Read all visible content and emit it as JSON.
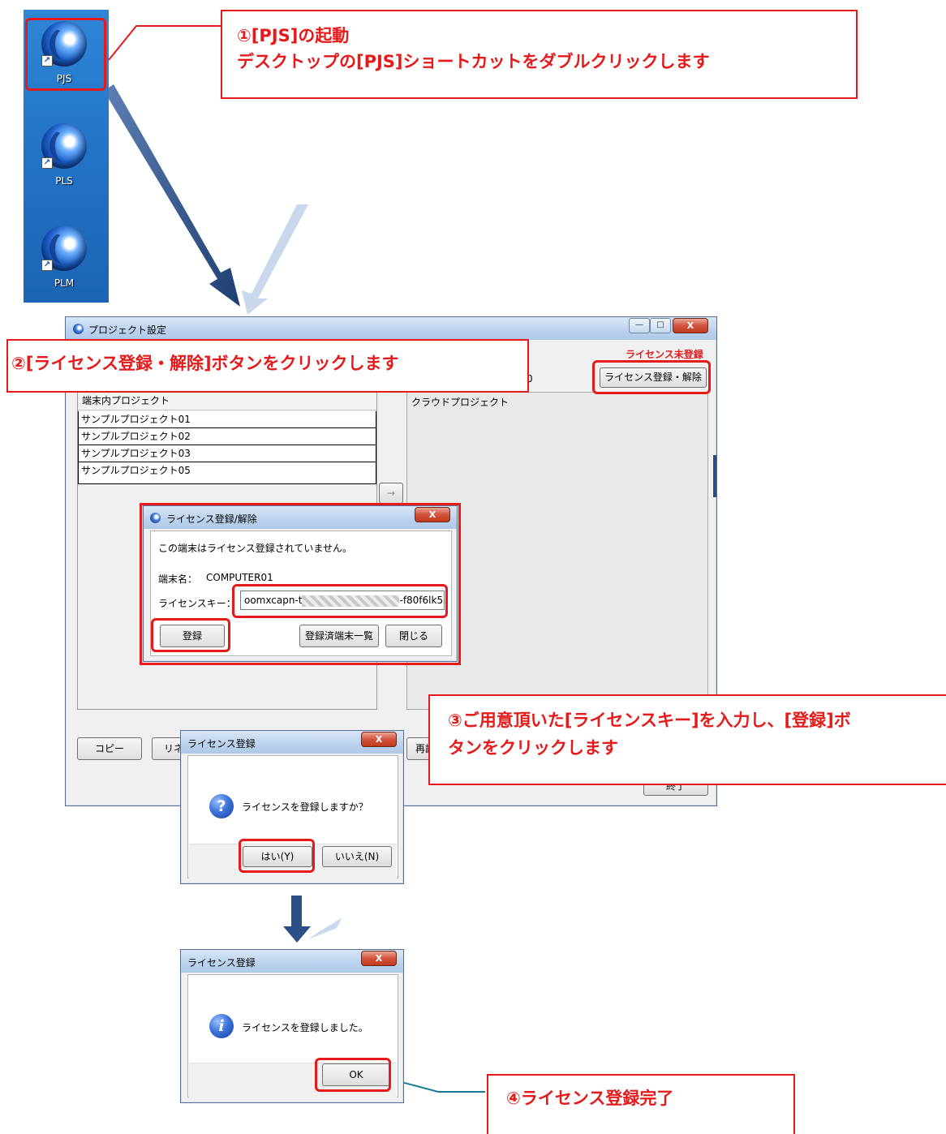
{
  "desktop": {
    "icons": [
      {
        "label": "PJS",
        "shortcut": "↗"
      },
      {
        "label": "PLS",
        "shortcut": "↗"
      },
      {
        "label": "PLM",
        "shortcut": "↗"
      }
    ]
  },
  "callouts": {
    "step1_line1": "①[PJS]の起動",
    "step1_line2": "デスクトップの[PJS]ショートカットをダブルクリックします",
    "step2": "②[ライセンス登録・解除]ボタンをクリックします",
    "step3_line1": "③ご用意頂いた[ライセンスキー]を入力し、[登録]ボ",
    "step3_line2": "タンをクリックします",
    "step4": "④ライセンス登録完了"
  },
  "project_window": {
    "title": "プロジェクト設定",
    "minimize": "—",
    "maximize": "□",
    "close": "X",
    "license_status": "ライセンス未登録",
    "partial_text": "0",
    "license_button": "ライセンス登録・解除",
    "local_header": "端末内プロジェクト",
    "cloud_header": "クラウドプロジェクト",
    "local_projects": [
      "サンプルプロジェクト01",
      "サンプルプロジェクト02",
      "サンプルプロジェクト03",
      "サンプルプロジェクト05"
    ],
    "arrow_button": "→",
    "copy_button": "コピー",
    "rename_button_partial": "リネ",
    "reload_partial": "再読",
    "bottom_right_partial": "終了"
  },
  "license_dialog": {
    "title": "ライセンス登録/解除",
    "close": "X",
    "message": "この端末はライセンス登録されていません。",
    "terminal_label": "端末名：",
    "terminal_value": "COMPUTER01",
    "key_label": "ライセンスキー：",
    "key_prefix": "oomxcapn-t",
    "key_suffix": "-f80f6lk5",
    "register_button": "登録",
    "list_button": "登録済端末一覧",
    "close_button": "閉じる"
  },
  "confirm_dialog": {
    "title": "ライセンス登録",
    "close": "X",
    "icon": "?",
    "message": "ライセンスを登録しますか？",
    "yes_button": "はい(Y)",
    "no_button": "いいえ(N)"
  },
  "done_dialog": {
    "title": "ライセンス登録",
    "close": "X",
    "icon": "i",
    "message": "ライセンスを登録しました。",
    "ok_button": "OK"
  },
  "colors": {
    "accent_red": "#e51a1a",
    "arrow_dark": "#2b4f86",
    "arrow_light": "#c9d8ec",
    "desktop_blue": "#2273c6"
  }
}
